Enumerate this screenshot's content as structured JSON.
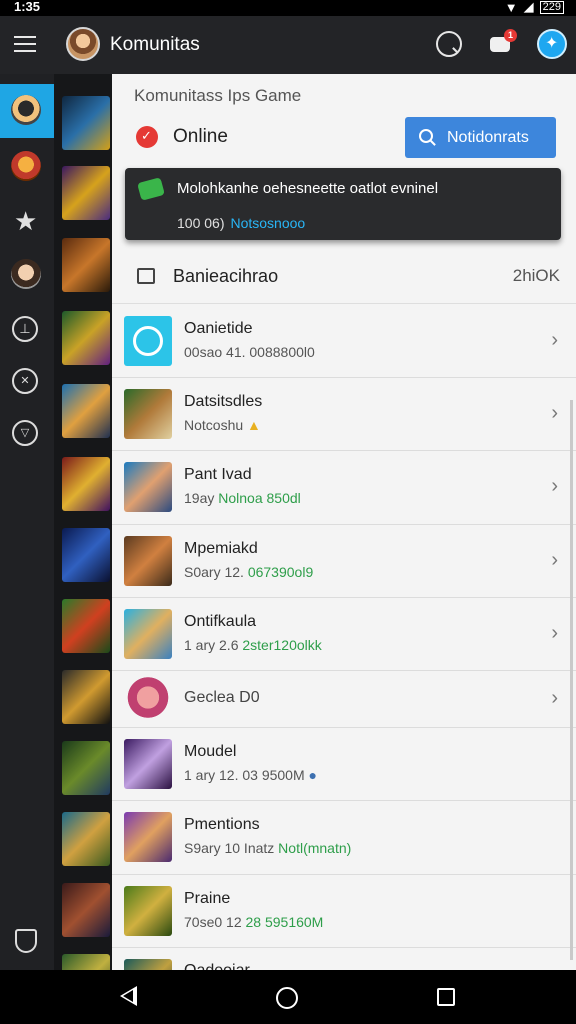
{
  "status_bar": {
    "time": "1:35",
    "battery": "229"
  },
  "app_bar": {
    "title": "Komunitas",
    "badge_count": "1"
  },
  "panel": {
    "subtitle": "Komunitass Ips Game",
    "online_label": "Online",
    "notif_button_label": "Notidonrats"
  },
  "toast": {
    "message": "Molohkanhe oehesneette oatlot evninel",
    "sub": "100 06)",
    "link": "Notsosnooo"
  },
  "section": {
    "title": "Banieacihrao",
    "count": "2hiOK"
  },
  "list": [
    {
      "name": "Oanietide",
      "sub": "00sao 41. 0088800l0",
      "accent": ""
    },
    {
      "name": "Datsitsdles",
      "sub": "Notcoshu",
      "accent": ""
    },
    {
      "name": "Pant Ivad",
      "sub": "19ay",
      "accent": "Nolnoa 850dl"
    },
    {
      "name": "Mpemiakd",
      "sub": "S0ary 12.",
      "accent": "067390ol9"
    },
    {
      "name": "Ontifkaula",
      "sub": "1 ary 2.6",
      "accent": "2ster120olkk"
    },
    {
      "name": "Geclea D0",
      "sub": "",
      "accent": ""
    },
    {
      "name": "Moudel",
      "sub": "1 ary 12. 03 9500M",
      "accent": ""
    },
    {
      "name": "Pmentions",
      "sub": "S9ary 10 Inatz",
      "accent": "Notl(mnatn)"
    },
    {
      "name": "Praine",
      "sub": "70se0 12",
      "accent": "28 595160M"
    },
    {
      "name": "Oadeoiar",
      "sub": "",
      "accent": ""
    }
  ],
  "colors": {
    "accent_blue": "#3d86dc",
    "rail_active": "#1fa6e4",
    "online_red": "#e53935",
    "green_text": "#2e9e4a"
  }
}
